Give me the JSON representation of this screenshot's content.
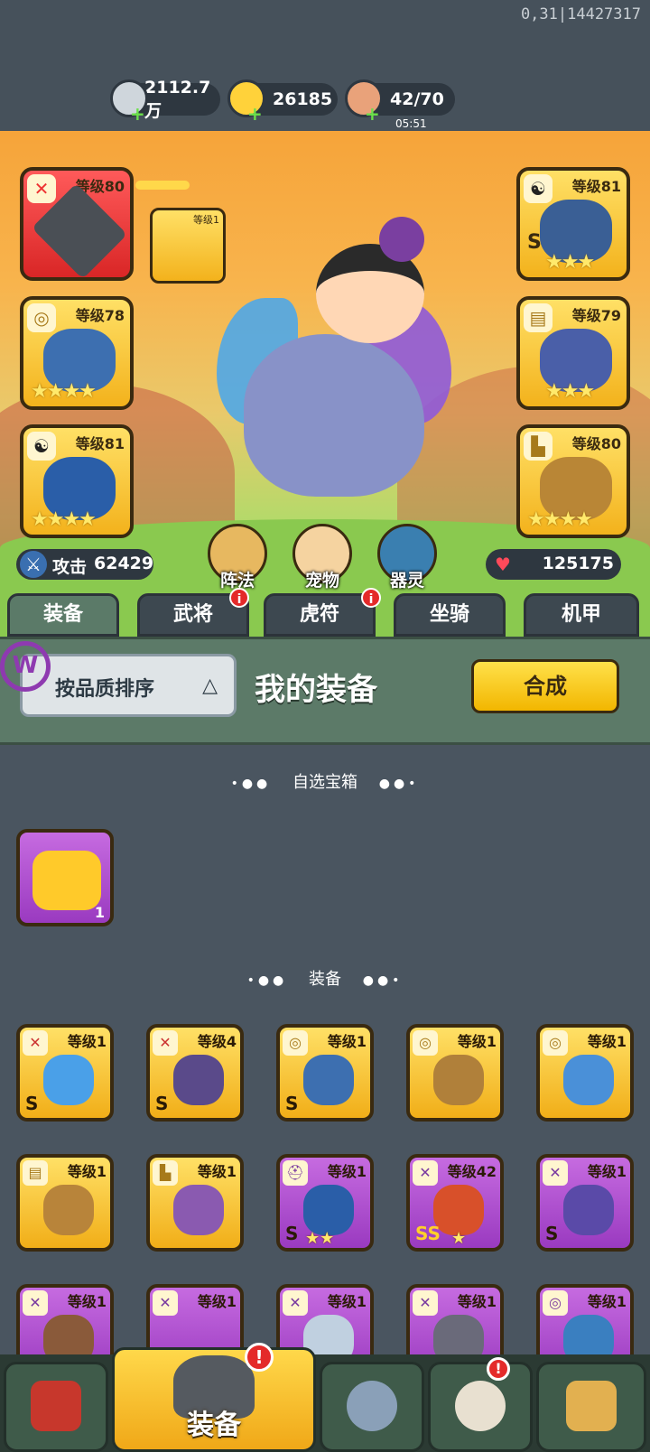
{
  "debug_text": "0,31|14427317",
  "resources": {
    "silver": {
      "value": "2112.7万",
      "icon": "silver-coin-icon"
    },
    "gold": {
      "value": "26185",
      "icon": "gold-ingot-icon"
    },
    "stamina": {
      "value": "42/70",
      "timer": "05:51",
      "icon": "meat-leg-icon"
    }
  },
  "equipped": {
    "weapon": {
      "level": "等级80"
    },
    "mini": {
      "level": "等级1"
    },
    "left2": {
      "level": "等级78"
    },
    "left3": {
      "level": "等级81"
    },
    "right1": {
      "level": "等级81"
    },
    "right2": {
      "level": "等级79"
    },
    "right3": {
      "level": "等级80"
    }
  },
  "stats": {
    "attack_label": "攻击",
    "attack": "62429",
    "hp": "125175"
  },
  "sub_buttons": [
    "阵法",
    "宠物",
    "器灵"
  ],
  "tabs": [
    "装备",
    "武将",
    "虎符",
    "坐骑",
    "机甲"
  ],
  "panel": {
    "sort_label": "按品质排序",
    "title": "我的装备",
    "synth_label": "合成"
  },
  "sections": {
    "chest": "自选宝箱",
    "equip": "装备"
  },
  "chest_item": {
    "count": "1"
  },
  "items_row1": [
    "等级1",
    "等级4",
    "等级1",
    "等级1",
    "等级1"
  ],
  "items_row2": [
    "等级1",
    "等级1",
    "等级1",
    "等级42",
    "等级1"
  ],
  "items_row3": [
    "等级1",
    "等级1",
    "等级1",
    "等级1",
    "等级1"
  ],
  "bottom_nav": {
    "active_label": "装备"
  },
  "colors": {
    "gold_frame": "#f3b21c",
    "purple_frame": "#9a3ac0",
    "accent_green": "#5c7a68",
    "alert_red": "#e42a2a"
  }
}
